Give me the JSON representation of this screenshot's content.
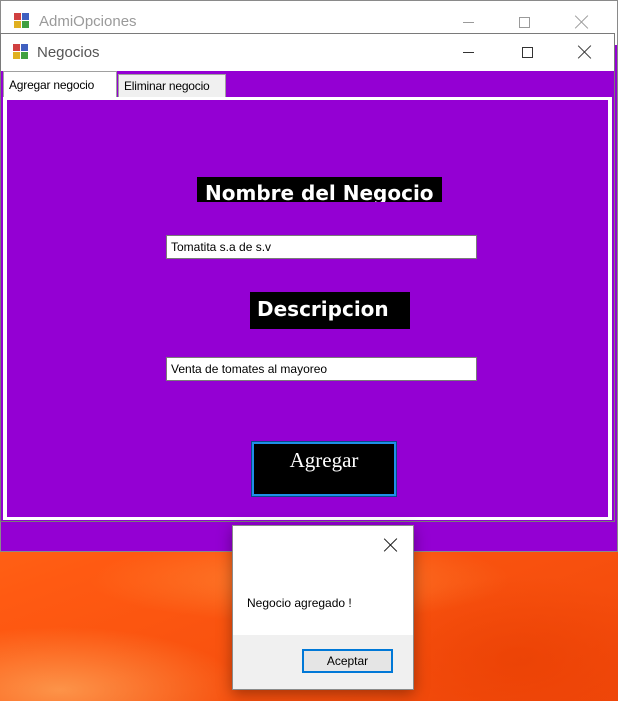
{
  "back_window": {
    "title": "AdmiOpciones"
  },
  "window": {
    "title": "Negocios"
  },
  "tabs": [
    {
      "label": "Agregar negocio",
      "active": true
    },
    {
      "label": "Eliminar negocio",
      "active": false
    }
  ],
  "form": {
    "name_label": "Nombre del Negocio",
    "name_value": "Tomatita s.a de s.v",
    "description_label": "Descripcion",
    "description_value": "Venta de tomates al mayoreo",
    "submit_label": "Agregar"
  },
  "message_box": {
    "text": "Negocio agregado !",
    "ok_label": "Aceptar"
  },
  "colors": {
    "form_background": "#9400d3",
    "label_background": "#000000",
    "focus_border": "#0078d7"
  },
  "icons": {
    "app": "app-window-icon",
    "minimize": "minimize-icon",
    "maximize": "maximize-icon",
    "close": "close-icon"
  }
}
